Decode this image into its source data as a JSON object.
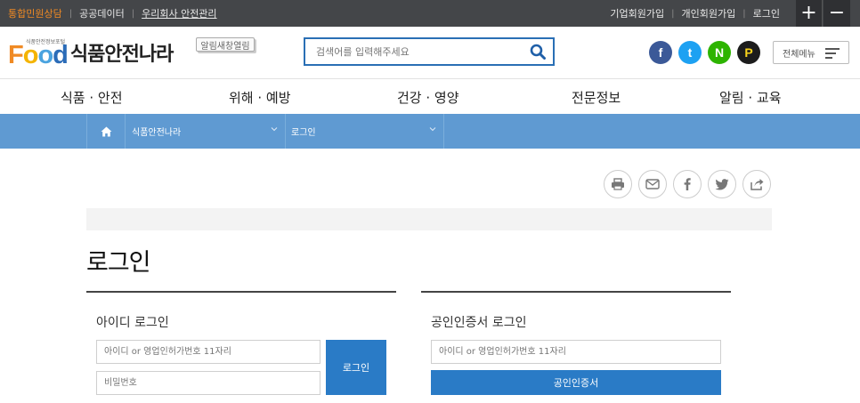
{
  "topbar": {
    "left_links": [
      "통합민원상담",
      "공공데이터",
      "우리회사 안전관리"
    ],
    "right_links": [
      "기업회원가입",
      "개인회원가입",
      "로그인"
    ],
    "zoom_in": "+",
    "zoom_out": "−"
  },
  "header": {
    "logo_word": [
      "F",
      "o",
      "o",
      "d"
    ],
    "logo_tagline": "식품안전정보포털",
    "logo_name": "식품안전나라",
    "alert_popup": "알림새창열림",
    "search_placeholder": "검색어를 입력해주세요",
    "sns": [
      "f",
      "t",
      "N",
      "P"
    ],
    "all_menu": "전체메뉴"
  },
  "gnb": [
    "식품 · 안전",
    "위해 · 예방",
    "건강 · 영양",
    "전문정보",
    "알림 · 교육"
  ],
  "breadcrumb": [
    "식품안전나라",
    "로그인"
  ],
  "page": {
    "title": "로그인"
  },
  "id_login": {
    "title": "아이디 로그인",
    "id_placeholder": "아이디 or 영업인허가번호 11자리",
    "pw_placeholder": "비밀번호",
    "button": "로그인"
  },
  "cert_login": {
    "title": "공인인증서 로그인",
    "id_placeholder": "아이디 or 영업인허가번호 11자리",
    "button": "공인인증서"
  },
  "colors": {
    "topbar": "#444649",
    "accent_orange": "#f08a24",
    "primary_blue": "#2a7bc6",
    "crumb_blue": "#5f9ad2"
  }
}
